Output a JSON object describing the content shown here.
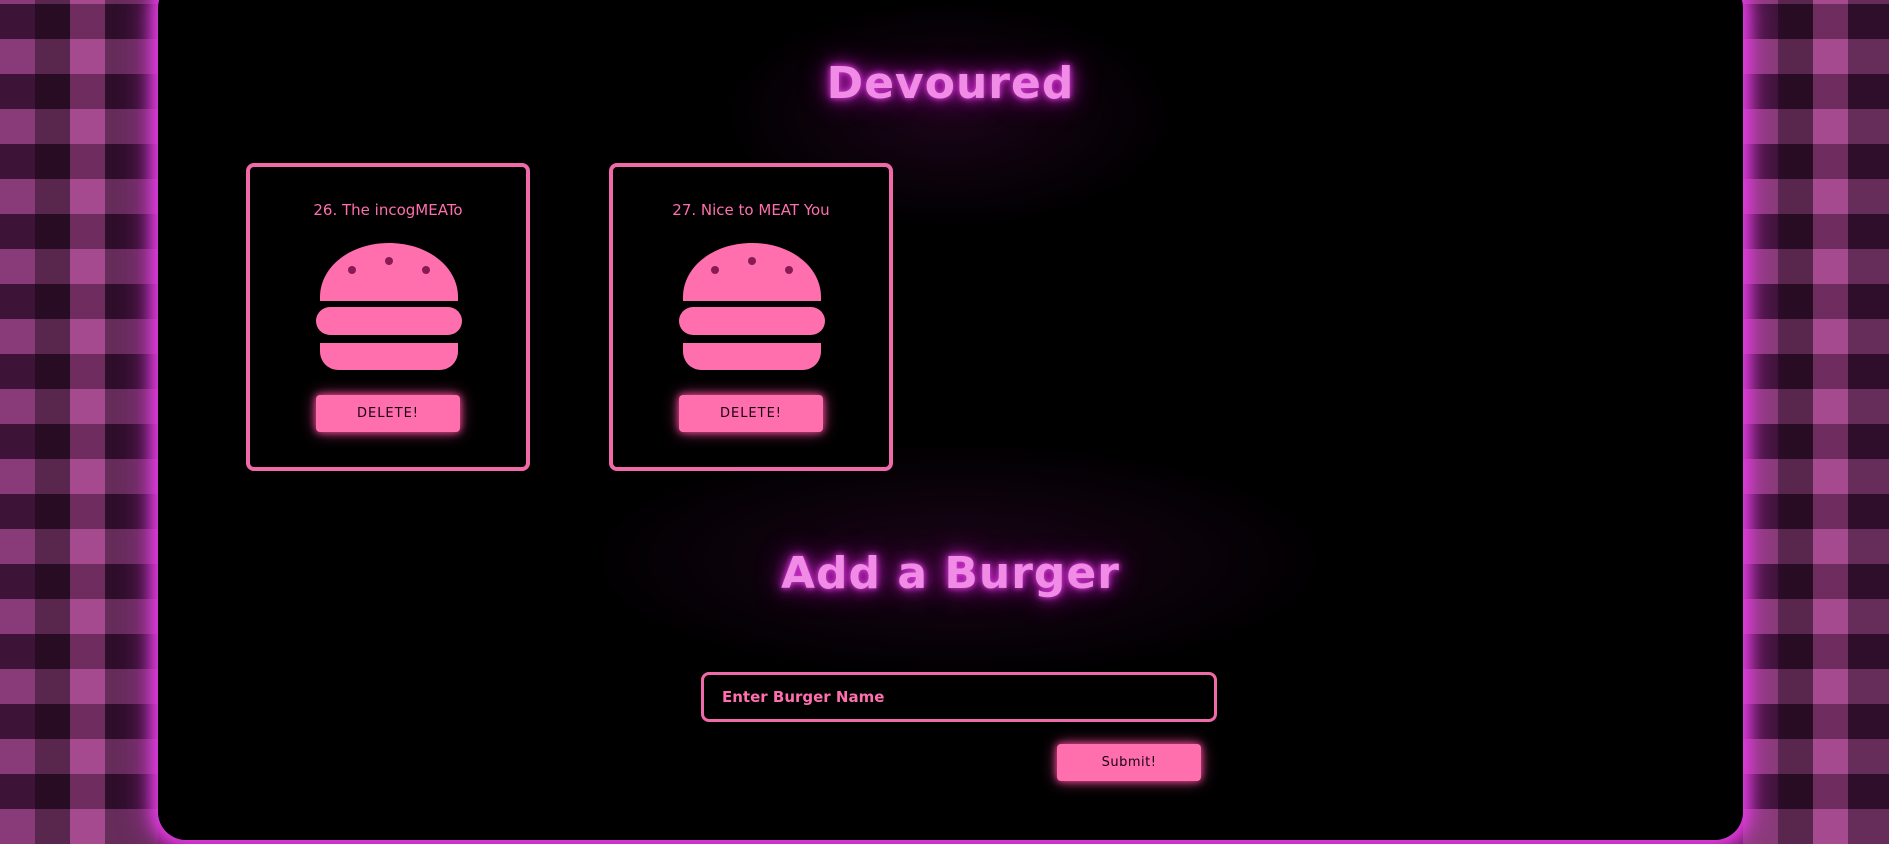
{
  "colors": {
    "accent": "#ff6fae",
    "border": "#f06aaa",
    "title": "#f08ce6",
    "frame_glow": "#e13be0",
    "background": "#000000"
  },
  "devoured": {
    "title": "Devoured",
    "burgers": [
      {
        "label": "26. The incogMEATo",
        "icon": "burger-icon",
        "delete_label": "DELETE!"
      },
      {
        "label": "27. Nice to MEAT You",
        "icon": "burger-icon",
        "delete_label": "DELETE!"
      }
    ]
  },
  "add_burger": {
    "title": "Add a Burger",
    "input_placeholder": "Enter Burger Name",
    "input_value": "",
    "submit_label": "Submit!"
  }
}
